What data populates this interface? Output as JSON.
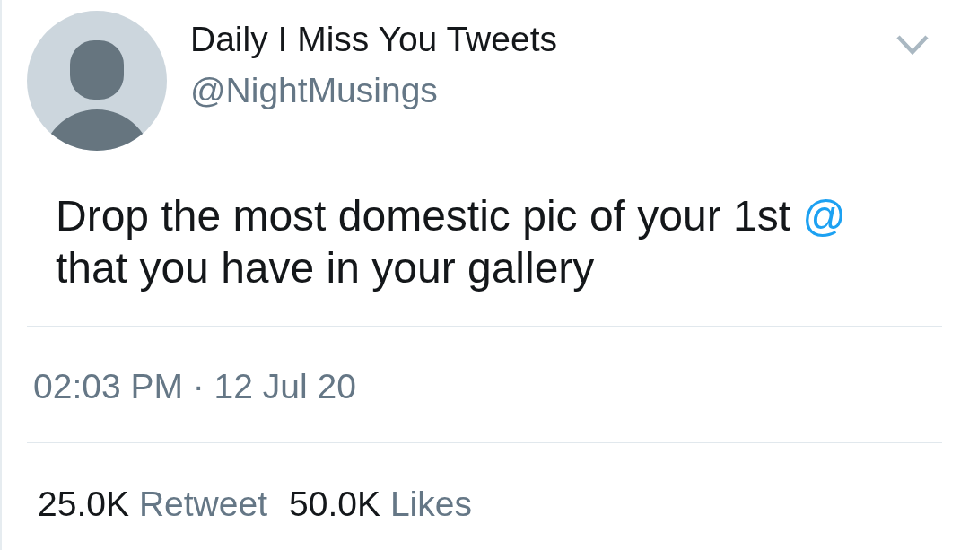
{
  "author": {
    "name": "Daily I Miss You Tweets",
    "handle": "@NightMusings"
  },
  "tweet": {
    "text": "Drop the most domestic pic of your 1st",
    "mention": "@",
    "rest": "that you have in your gallery"
  },
  "timestamp": "02:03 PM · 12 Jul 20",
  "stats": [
    {
      "count": "25.0K",
      "label": "Retweet"
    },
    {
      "count": "50.0K",
      "label": "Likes"
    }
  ]
}
